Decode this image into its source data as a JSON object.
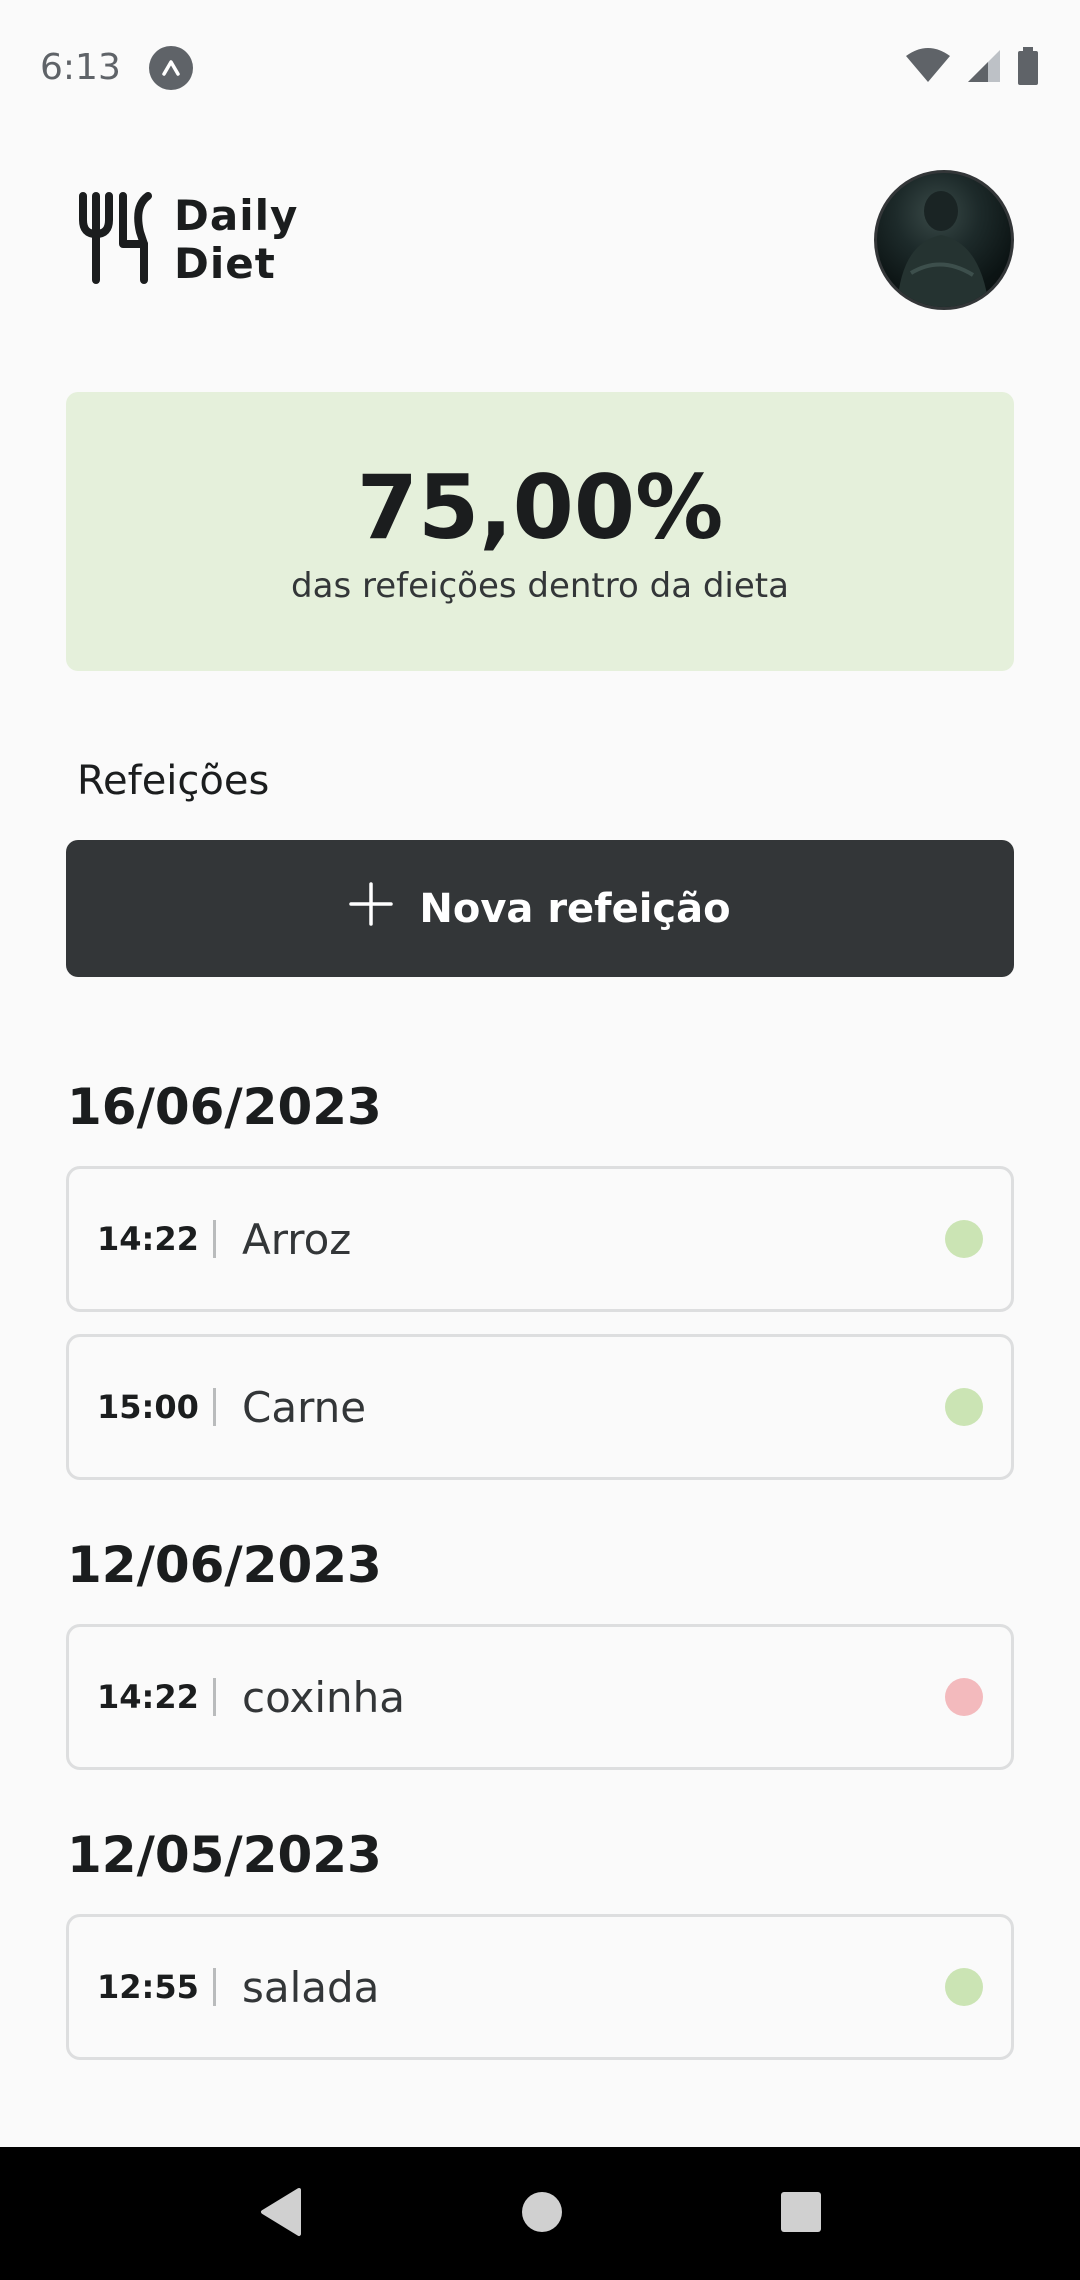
{
  "status_bar": {
    "time": "6:13"
  },
  "header": {
    "logo_line1": "Daily",
    "logo_line2": "Diet"
  },
  "stats": {
    "percent": "75,00%",
    "description": "das refeições dentro da dieta",
    "bg_color": "#E5F0DB"
  },
  "meals_section": {
    "label": "Refeições",
    "new_button_label": "Nova refeição"
  },
  "days": [
    {
      "date": "16/06/2023",
      "meals": [
        {
          "time": "14:22",
          "name": "Arroz",
          "in_diet": true
        },
        {
          "time": "15:00",
          "name": "Carne",
          "in_diet": true
        }
      ]
    },
    {
      "date": "12/06/2023",
      "meals": [
        {
          "time": "14:22",
          "name": "coxinha",
          "in_diet": false
        }
      ]
    },
    {
      "date": "12/05/2023",
      "meals": [
        {
          "time": "12:55",
          "name": "salada",
          "in_diet": true
        }
      ]
    }
  ],
  "colors": {
    "in_diet_dot": "#CBE4B4",
    "off_diet_dot": "#F3BABD",
    "dark_button": "#333638"
  },
  "nav": {
    "back": "back-icon",
    "home": "home-icon",
    "recents": "recents-icon"
  }
}
